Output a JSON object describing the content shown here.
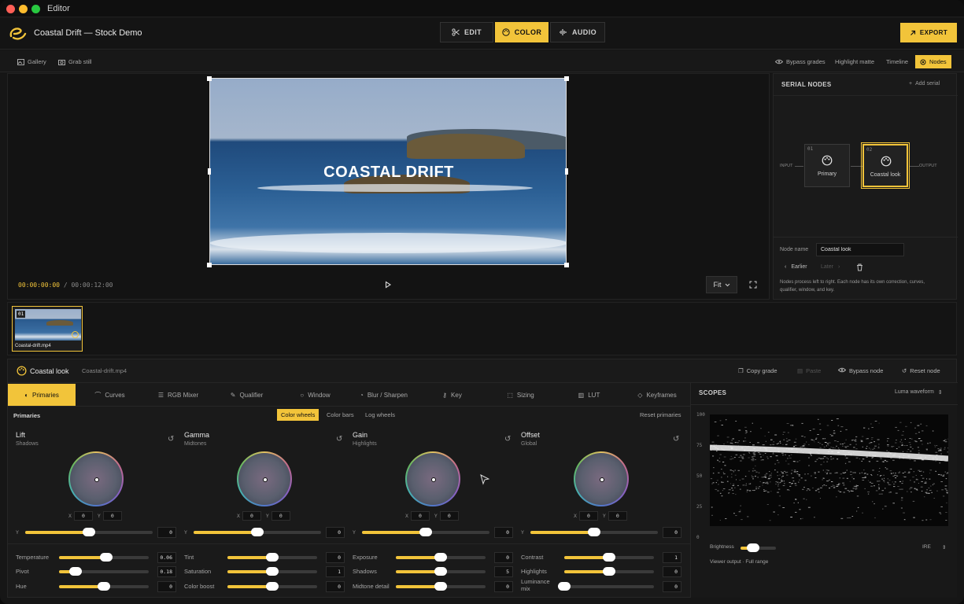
{
  "window": {
    "title": "Editor"
  },
  "project": {
    "title": "Coastal Drift — Stock Demo"
  },
  "modes": [
    {
      "label": "EDIT",
      "icon": "scissors-icon"
    },
    {
      "label": "COLOR",
      "icon": "palette-icon",
      "active": true
    },
    {
      "label": "AUDIO",
      "icon": "waveform-icon"
    }
  ],
  "export_label": "EXPORT",
  "subbar": {
    "left": [
      {
        "label": "Gallery",
        "icon": "gallery-icon"
      },
      {
        "label": "Grab still",
        "icon": "camera-icon"
      }
    ],
    "right": [
      {
        "label": "Bypass grades",
        "icon": "eye-icon"
      },
      {
        "label": "Highlight matte"
      },
      {
        "label": "Timeline"
      },
      {
        "label": "Nodes",
        "icon": "nodes-icon",
        "active": true
      }
    ]
  },
  "viewer": {
    "caption": "COASTAL DRIFT",
    "timecode_current": "00:00:00:00",
    "timecode_sep": "/",
    "timecode_total": "00:00:12:00",
    "fit_label": "Fit"
  },
  "nodes_panel": {
    "title": "SERIAL NODES",
    "add_label": "Add serial",
    "input_label": "INPUT",
    "output_label": "OUTPUT",
    "nodes": [
      {
        "num": "01",
        "label": "Primary"
      },
      {
        "num": "02",
        "label": "Coastal look",
        "selected": true
      }
    ],
    "name_label": "Node name",
    "name_value": "Coastal look",
    "earlier_label": "Earlier",
    "later_label": "Later",
    "help_text_1": "Nodes process left to right. Each node has its own correction, curves,",
    "help_text_2": "qualifier, window, and key."
  },
  "clip": {
    "num": "01",
    "name": "Coastal-drift.mp4"
  },
  "grade_header": {
    "title": "Coastal look",
    "file": "Coastal-drift.mp4",
    "actions": [
      "Copy grade",
      "Paste",
      "Bypass node",
      "Reset node"
    ]
  },
  "tabs": [
    {
      "label": "Primaries",
      "icon": "palette-icon",
      "active": true
    },
    {
      "label": "Curves",
      "icon": "curve-icon"
    },
    {
      "label": "RGB Mixer",
      "icon": "sliders-icon"
    },
    {
      "label": "Qualifier",
      "icon": "eyedropper-icon"
    },
    {
      "label": "Window",
      "icon": "circle-icon"
    },
    {
      "label": "Blur / Sharpen",
      "icon": "droplet-icon"
    },
    {
      "label": "Key",
      "icon": "key-icon"
    },
    {
      "label": "Sizing",
      "icon": "crop-icon"
    },
    {
      "label": "LUT",
      "icon": "chart-icon"
    },
    {
      "label": "Keyframes",
      "icon": "keyframe-icon"
    }
  ],
  "primaries": {
    "title": "Primaries",
    "modes": [
      {
        "label": "Color wheels",
        "active": true
      },
      {
        "label": "Color bars"
      },
      {
        "label": "Log wheels"
      }
    ],
    "reset_label": "Reset primaries",
    "wheels": [
      {
        "name": "Lift",
        "sub": "Shadows",
        "x": "0",
        "y": "0",
        "y_label": "Y",
        "y_value": "0",
        "y_level": 0.5
      },
      {
        "name": "Gamma",
        "sub": "Midtones",
        "x": "0",
        "y": "0",
        "y_label": "Y",
        "y_value": "0",
        "y_level": 0.5
      },
      {
        "name": "Gain",
        "sub": "Highlights",
        "x": "0",
        "y": "0",
        "y_label": "Y",
        "y_value": "0",
        "y_level": 0.5
      },
      {
        "name": "Offset",
        "sub": "Global",
        "x": "0",
        "y": "0",
        "y_label": "Y",
        "y_value": "0",
        "y_level": 0.5
      }
    ],
    "x_label": "X",
    "yy_label": "Y",
    "adjustments": [
      [
        {
          "label": "Temperature",
          "value": "0.06",
          "level": 0.53
        },
        {
          "label": "Pivot",
          "value": "0.18",
          "level": 0.18
        },
        {
          "label": "Hue",
          "value": "0",
          "level": 0.5
        }
      ],
      [
        {
          "label": "Tint",
          "value": "0",
          "level": 0.5
        },
        {
          "label": "Saturation",
          "value": "1",
          "level": 0.5
        },
        {
          "label": "Color boost",
          "value": "0",
          "level": 0.5
        }
      ],
      [
        {
          "label": "Exposure",
          "value": "0",
          "level": 0.5
        },
        {
          "label": "Shadows",
          "value": "5",
          "level": 0.5
        },
        {
          "label": "Midtone detail",
          "value": "0",
          "level": 0.5
        }
      ],
      [
        {
          "label": "Contrast",
          "value": "1",
          "level": 0.5
        },
        {
          "label": "Highlights",
          "value": "0",
          "level": 0.5
        },
        {
          "label": "Luminance mix",
          "value": "0",
          "level": 0.0
        }
      ]
    ]
  },
  "scopes": {
    "title": "SCOPES",
    "mode": "Luma waveform",
    "ticks": [
      "100",
      "75",
      "50",
      "25",
      "0"
    ],
    "brightness_label": "Brightness",
    "brightness_level": 0.35,
    "unit": "IRE",
    "footer": "Viewer output · Full range"
  },
  "colors": {
    "accent": "#f2c43a",
    "bg": "#161616"
  }
}
